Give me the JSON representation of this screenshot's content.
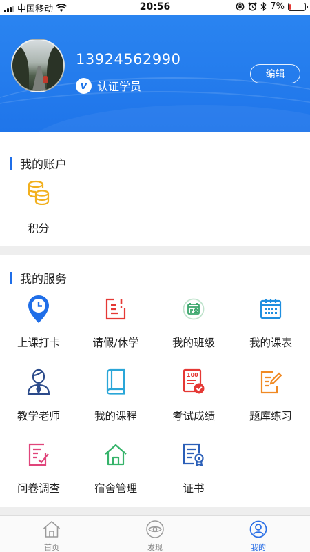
{
  "status_bar": {
    "carrier": "中国移动",
    "time": "20:56",
    "battery_percent": "7%",
    "battery_level": 0.07,
    "icons": [
      "signal-icon",
      "wifi-icon",
      "lock-rotation-icon",
      "alarm-icon",
      "bluetooth-icon",
      "battery-icon"
    ]
  },
  "profile": {
    "phone": "13924562990",
    "verify_badge": "v",
    "verify_label": "认证学员",
    "edit_label": "编辑"
  },
  "account": {
    "title": "我的账户",
    "items": [
      {
        "label": "积分",
        "icon": "coins-icon",
        "color": "#f2b01e"
      }
    ]
  },
  "services": {
    "title": "我的服务",
    "items": [
      {
        "label": "上课打卡",
        "icon": "location-clock-icon",
        "color": "#1f6ee8"
      },
      {
        "label": "请假/休学",
        "icon": "leave-form-icon",
        "color": "#e53935"
      },
      {
        "label": "我的班级",
        "icon": "class-icon",
        "color": "#3aa66b"
      },
      {
        "label": "我的课表",
        "icon": "calendar-icon",
        "color": "#1f8fe0"
      },
      {
        "label": "教学老师",
        "icon": "teacher-icon",
        "color": "#2b4a8a"
      },
      {
        "label": "我的课程",
        "icon": "book-icon",
        "color": "#2aa6d8"
      },
      {
        "label": "考试成绩",
        "icon": "exam-score-icon",
        "color": "#e53935"
      },
      {
        "label": "题库练习",
        "icon": "practice-edit-icon",
        "color": "#f08a24"
      },
      {
        "label": "问卷调查",
        "icon": "survey-icon",
        "color": "#e0457b"
      },
      {
        "label": "宿舍管理",
        "icon": "dorm-house-icon",
        "color": "#36b36a"
      },
      {
        "label": "证书",
        "icon": "certificate-icon",
        "color": "#2b5fb8"
      }
    ]
  },
  "tabbar": {
    "tabs": [
      {
        "label": "首页",
        "icon": "home-icon",
        "active": false
      },
      {
        "label": "发现",
        "icon": "eye-icon",
        "active": false
      },
      {
        "label": "我的",
        "icon": "user-icon",
        "active": true
      }
    ],
    "active_color": "#2a6fe6"
  }
}
